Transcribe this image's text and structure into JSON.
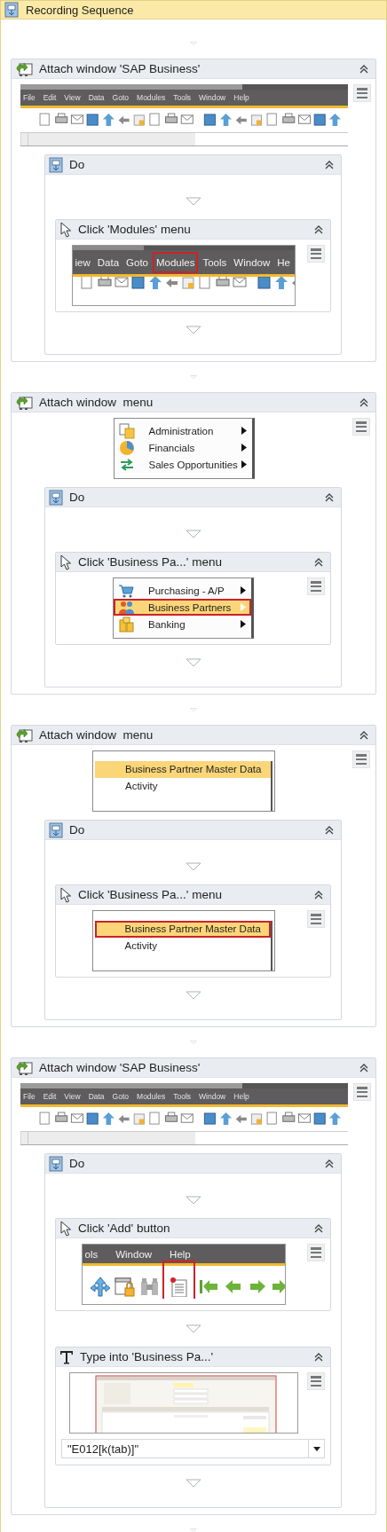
{
  "sequence": {
    "title": "Recording Sequence",
    "activities": [
      {
        "kind": "attach",
        "title": "Attach window 'SAP Business'",
        "expanded": true,
        "capture": {
          "kind": "app_toolbar",
          "menu": [
            {
              "label": "File",
              "target": false
            },
            {
              "label": "Edit",
              "target": false
            },
            {
              "label": "View",
              "target": false
            },
            {
              "label": "Data",
              "target": false
            },
            {
              "label": "Goto",
              "target": false
            },
            {
              "label": "Modules",
              "target": false
            },
            {
              "label": "Tools",
              "target": false
            },
            {
              "label": "Window",
              "target": false
            },
            {
              "label": "Help",
              "target": false
            }
          ]
        },
        "children": [
          {
            "kind": "do",
            "title": "Do",
            "expanded": true,
            "children": [
              {
                "kind": "click",
                "title": "Click 'Modules' menu",
                "expanded": true,
                "capture": {
                  "kind": "menubar",
                  "menu": [
                    {
                      "label": "iew",
                      "target": false
                    },
                    {
                      "label": "Data",
                      "target": false
                    },
                    {
                      "label": "Goto",
                      "target": false
                    },
                    {
                      "label": "Modules",
                      "target": true
                    },
                    {
                      "label": "Tools",
                      "target": false
                    },
                    {
                      "label": "Window",
                      "target": false
                    },
                    {
                      "label": "He",
                      "target": false
                    }
                  ]
                }
              }
            ]
          }
        ]
      },
      {
        "kind": "attach",
        "title": "Attach window  menu",
        "expanded": true,
        "capture": {
          "kind": "module_menu",
          "items": [
            {
              "kind": "document",
              "label": "Administration",
              "selected": false,
              "target": false
            },
            {
              "kind": "pie",
              "label": "Financials",
              "selected": false,
              "target": false
            },
            {
              "kind": "arrows",
              "label": "Sales Opportunities",
              "selected": false,
              "target": false
            }
          ]
        },
        "children": [
          {
            "kind": "do",
            "title": "Do",
            "expanded": true,
            "children": [
              {
                "kind": "click",
                "title": "Click 'Business Pa...' menu",
                "expanded": true,
                "capture": {
                  "kind": "module_menu",
                  "items": [
                    {
                      "kind": "cart",
                      "label": "Purchasing - A/P",
                      "selected": false,
                      "target": false
                    },
                    {
                      "kind": "people",
                      "label": "Business Partners",
                      "selected": true,
                      "target": true
                    },
                    {
                      "kind": "coins",
                      "label": "Banking",
                      "selected": false,
                      "target": false
                    }
                  ]
                }
              }
            ]
          }
        ]
      },
      {
        "kind": "attach",
        "title": "Attach window  menu",
        "expanded": true,
        "capture": {
          "kind": "submenu",
          "items": [
            {
              "label": "Business Partner Master Data",
              "selected": true,
              "target": false
            },
            {
              "label": "Activity",
              "selected": false,
              "target": false
            }
          ]
        },
        "children": [
          {
            "kind": "do",
            "title": "Do",
            "expanded": true,
            "children": [
              {
                "kind": "click",
                "title": "Click 'Business Pa...' menu",
                "expanded": true,
                "capture": {
                  "kind": "submenu",
                  "items": [
                    {
                      "label": "Business Partner Master Data",
                      "selected": true,
                      "target": true
                    },
                    {
                      "label": "Activity",
                      "selected": false,
                      "target": false
                    }
                  ]
                }
              }
            ]
          }
        ]
      },
      {
        "kind": "attach",
        "title": "Attach window 'SAP Business'",
        "expanded": true,
        "capture": {
          "kind": "app_toolbar",
          "menu": [
            {
              "label": "File",
              "target": false
            },
            {
              "label": "Edit",
              "target": false
            },
            {
              "label": "View",
              "target": false
            },
            {
              "label": "Data",
              "target": false
            },
            {
              "label": "Goto",
              "target": false
            },
            {
              "label": "Modules",
              "target": false
            },
            {
              "label": "Tools",
              "target": false
            },
            {
              "label": "Window",
              "target": false
            },
            {
              "label": "Help",
              "target": false
            }
          ]
        },
        "children": [
          {
            "kind": "do",
            "title": "Do",
            "expanded": true,
            "children": [
              {
                "kind": "click",
                "title": "Click 'Add' button",
                "expanded": true,
                "capture": {
                  "kind": "add_toolbar",
                  "menu": [
                    {
                      "label": "ols",
                      "target": false
                    },
                    {
                      "label": "Window",
                      "target": false
                    },
                    {
                      "label": "Help",
                      "target": false
                    }
                  ],
                  "icons": [
                    {
                      "kind": "move",
                      "target": false
                    },
                    {
                      "kind": "lock_window",
                      "target": false
                    },
                    {
                      "kind": "binoculars",
                      "target": false
                    },
                    {
                      "kind": "form",
                      "target": true
                    },
                    {
                      "kind": "first",
                      "target": false
                    },
                    {
                      "kind": "prev",
                      "target": false
                    },
                    {
                      "kind": "next",
                      "target": false
                    },
                    {
                      "kind": "last",
                      "target": false
                    }
                  ]
                }
              },
              {
                "kind": "type",
                "title": "Type into 'Business Pa...'",
                "expanded": true,
                "field": {
                  "value": "\"E012[k(tab)]\""
                }
              }
            ]
          }
        ]
      }
    ]
  }
}
